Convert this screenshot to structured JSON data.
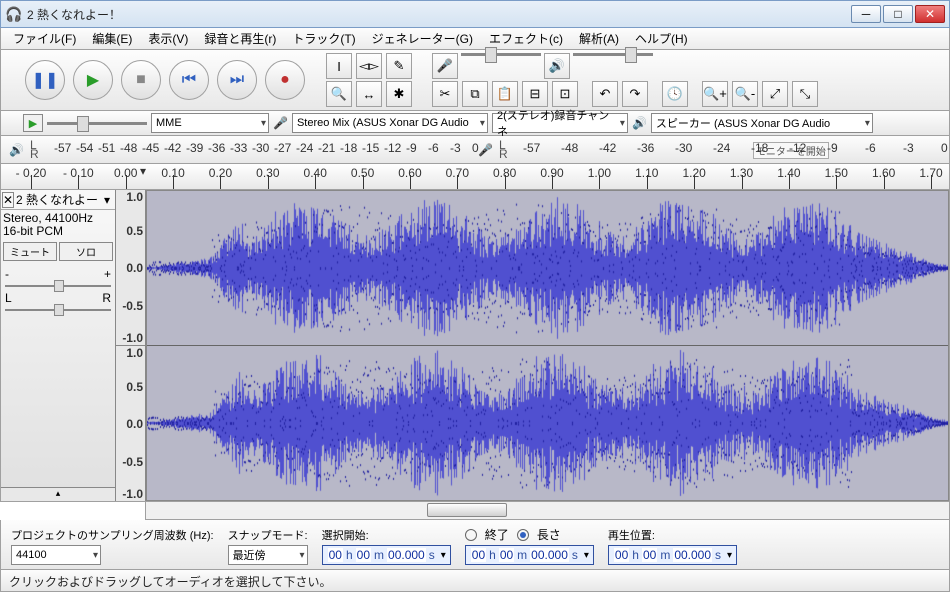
{
  "title": "2 熱くなれよー！",
  "menu": [
    "ファイル(F)",
    "編集(E)",
    "表示(V)",
    "録音と再生(r)",
    "トラック(T)",
    "ジェネレーター(G)",
    "エフェクト(c)",
    "解析(A)",
    "ヘルプ(H)"
  ],
  "host_combo": "MME",
  "rec_device": "Stereo Mix (ASUS Xonar DG Audio",
  "rec_channels": "2(ステレオ)録音チャンネ",
  "play_device": "スピーカー (ASUS Xonar DG Audio",
  "db_ticks_play": [
    "-57",
    "-54",
    "-51",
    "-48",
    "-45",
    "-42",
    "-39",
    "-36",
    "-33",
    "-30",
    "-27",
    "-24",
    "-21",
    "-18",
    "-15",
    "-12",
    "-9",
    "-6",
    "-3",
    "0"
  ],
  "db_ticks_rec": [
    "-57",
    "-48",
    "-42",
    "-36",
    "-30",
    "-24",
    "-18",
    "-12",
    "-9",
    "-6",
    "-3",
    "0"
  ],
  "monitor_label": "モニターを開始",
  "timeline_ticks": [
    "- 0.20",
    "- 0.10",
    "0.00",
    "0.10",
    "0.20",
    "0.30",
    "0.40",
    "0.50",
    "0.60",
    "0.70",
    "0.80",
    "0.90",
    "1.00",
    "1.10",
    "1.20",
    "1.30",
    "1.40",
    "1.50",
    "1.60",
    "1.70"
  ],
  "track": {
    "name": "2 熱くなれよー！",
    "info1": "Stereo, 44100Hz",
    "info2": "16-bit PCM",
    "mute": "ミュート",
    "solo": "ソロ",
    "pan_l": "L",
    "pan_r": "R"
  },
  "vscale": [
    "1.0",
    "0.5",
    "0.0",
    "-0.5",
    "-1.0"
  ],
  "bottom": {
    "rate_label": "プロジェクトのサンプリング周波数 (Hz):",
    "rate_value": "44100",
    "snap_label": "スナップモード:",
    "snap_value": "最近傍",
    "sel_start": "選択開始:",
    "end_label": "終了",
    "len_label": "長さ",
    "play_pos": "再生位置:"
  },
  "timecode_template": {
    "h": "00",
    "m": "00",
    "s": "00.000"
  },
  "status": "クリックおよびドラッグしてオーディオを選択して下さい。"
}
